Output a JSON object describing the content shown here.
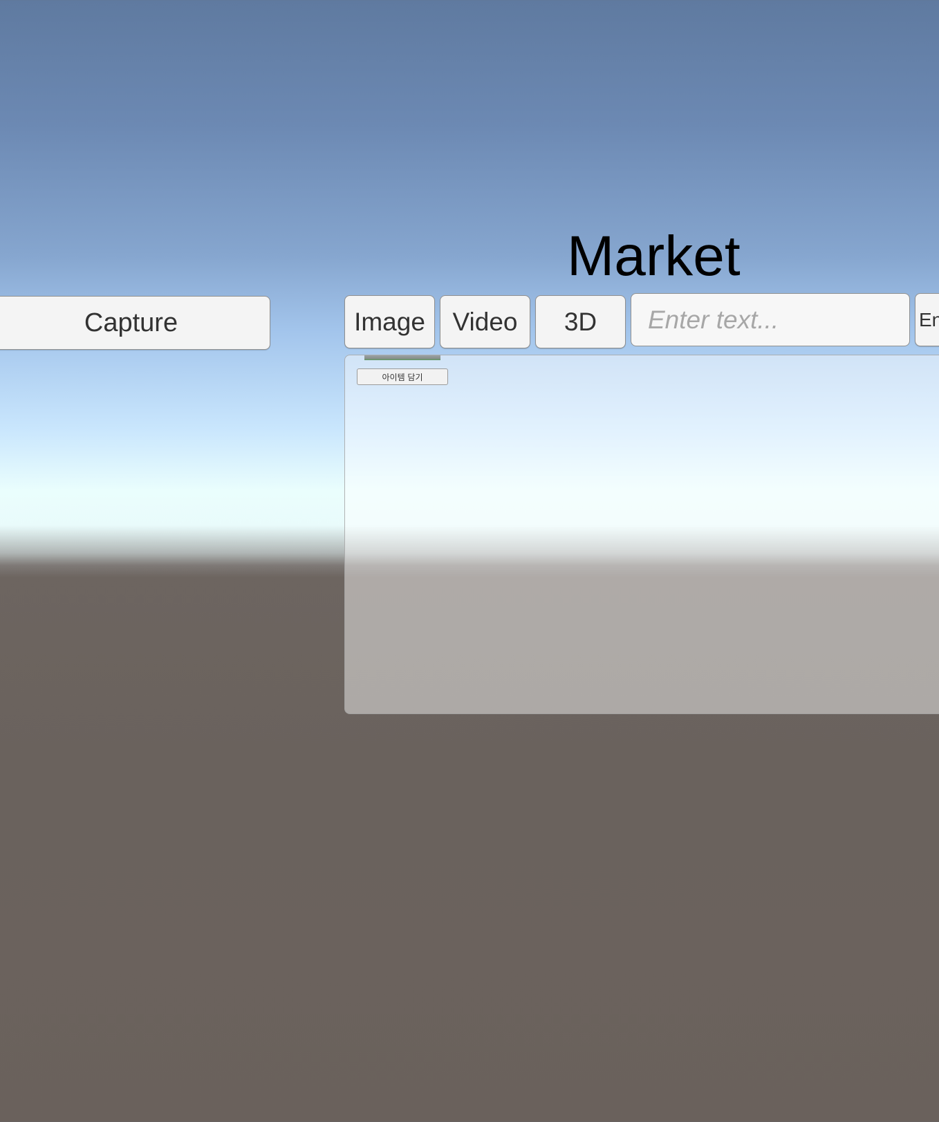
{
  "capture": {
    "label": "Capture"
  },
  "market": {
    "title": "Market",
    "tabs": [
      {
        "label": "Image"
      },
      {
        "label": "Video"
      },
      {
        "label": "3D"
      }
    ],
    "search": {
      "placeholder": "Enter text...",
      "value": ""
    },
    "enter": {
      "label": "En"
    },
    "panel": {
      "add_item_label": "아이템 담기"
    }
  }
}
